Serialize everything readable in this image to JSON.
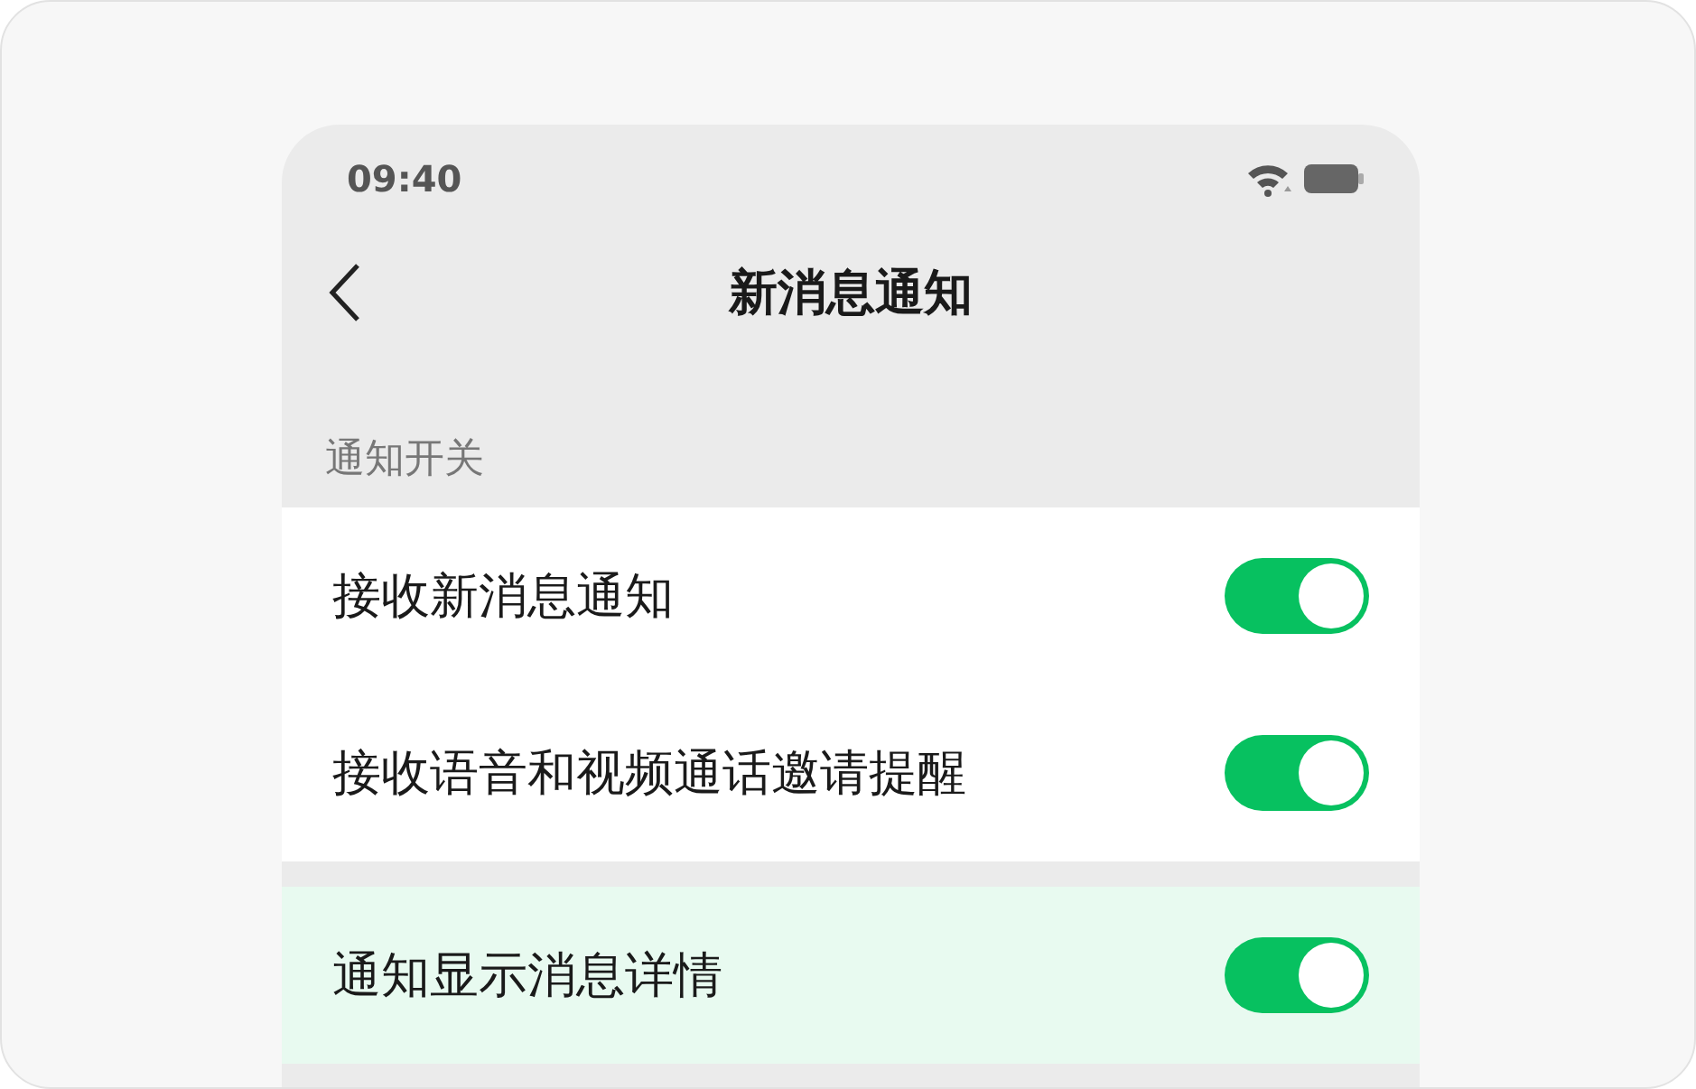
{
  "status_bar": {
    "time": "09:40"
  },
  "nav": {
    "title": "新消息通知"
  },
  "groups": [
    {
      "label": "通知开关",
      "rows": [
        {
          "label": "接收新消息通知",
          "on": true,
          "highlighted": false
        },
        {
          "label": "接收语音和视频通话邀请提醒",
          "on": true,
          "highlighted": false
        }
      ]
    },
    {
      "rows": [
        {
          "label": "通知显示消息详情",
          "on": true,
          "highlighted": true
        }
      ]
    }
  ]
}
